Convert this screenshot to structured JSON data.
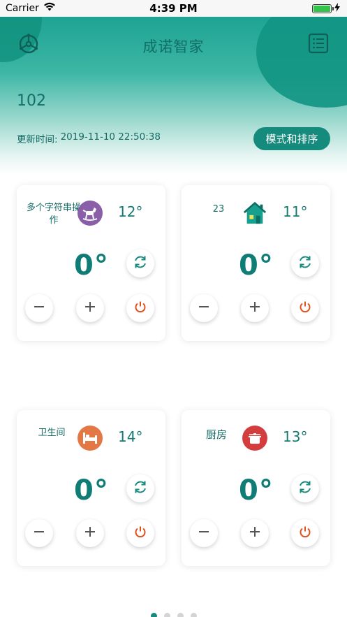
{
  "status_bar": {
    "carrier": "Carrier",
    "time": "4:39 PM",
    "battery_level": 1.0
  },
  "header": {
    "title": "成诺智家",
    "room_number": "102",
    "update_label": "更新时间:",
    "update_time": "2019-11-10 22:50:38",
    "mode_button_label": "模式和排序",
    "settings_icon": "settings-icon",
    "menu_icon": "list-icon"
  },
  "rooms": [
    {
      "name": "多个字符串操作",
      "icon": "rocking-horse-icon",
      "icon_color": "#8a5fa7",
      "current_temp": "12°",
      "set_temp": "0°"
    },
    {
      "name": "23",
      "icon": "house-icon",
      "icon_color": "#138a7b",
      "current_temp": "11°",
      "set_temp": "0°"
    },
    {
      "name": "卫生间",
      "icon": "bed-icon",
      "icon_color": "#e37845",
      "current_temp": "14°",
      "set_temp": "0°"
    },
    {
      "name": "厨房",
      "icon": "cooking-pot-icon",
      "icon_color": "#d43d3d",
      "current_temp": "13°",
      "set_temp": "0°"
    }
  ],
  "controls": {
    "refresh_icon": "refresh-icon",
    "minus_icon": "minus-icon",
    "plus_icon": "plus-icon",
    "power_icon": "power-icon",
    "power_color": "#e0511c"
  },
  "pagination": {
    "total": 4,
    "current": 1
  },
  "colors": {
    "accent": "#148b7d",
    "text": "#136b64"
  }
}
